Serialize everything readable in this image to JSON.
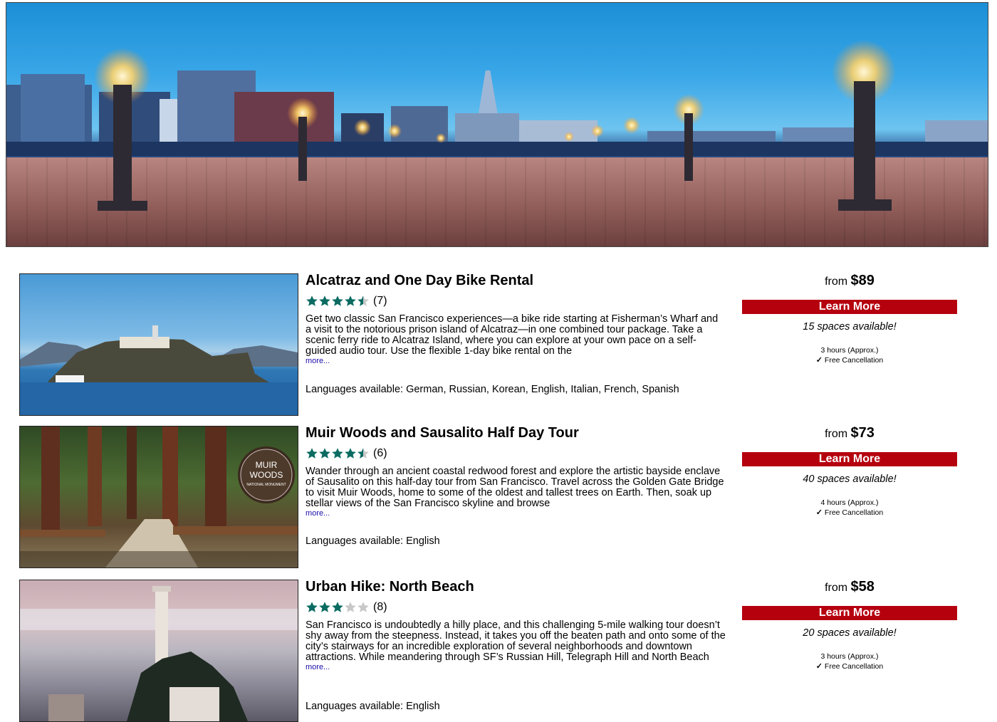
{
  "hero": {
    "alt": "San Francisco pier at dusk"
  },
  "tours": [
    {
      "title": "Alcatraz and One Day Bike Rental",
      "rating": 4.5,
      "reviews": "(7)",
      "description": "Get two classic San Francisco experiences—a bike ride starting at Fisherman’s Wharf and a visit to the notorious prison island of Alcatraz—in one combined tour package. Take a scenic ferry ride to Alcatraz Island, where you can explore at your own pace on a self-guided audio tour. Use the flexible 1-day bike rental on the",
      "more": "more...",
      "languages": "Languages available: German, Russian, Korean, English, Italian, French, Spanish",
      "from_label": "from",
      "price": "$89",
      "button": "Learn More",
      "spaces": "15 spaces available!",
      "duration": "3 hours (Approx.)",
      "cancellation": "Free Cancellation"
    },
    {
      "title": "Muir Woods and Sausalito Half Day Tour",
      "rating": 4.5,
      "reviews": "(6)",
      "description": "Wander through an ancient coastal redwood forest and explore the artistic bayside enclave of Sausalito on this half-day tour from San Francisco. Travel across the Golden Gate Bridge to visit Muir Woods, home to some of the oldest and tallest trees on Earth. Then, soak up stellar views of the San Francisco skyline and browse",
      "more": "more...",
      "languages": "Languages available: English",
      "from_label": "from",
      "price": "$73",
      "button": "Learn More",
      "spaces": "40 spaces available!",
      "duration": "4 hours (Approx.)",
      "cancellation": "Free Cancellation",
      "sign_line1": "MUIR",
      "sign_line2": "WOODS",
      "sign_line3": "NATIONAL MONUMENT"
    },
    {
      "title": "Urban Hike: North Beach",
      "rating": 3,
      "reviews": "(8)",
      "description": "San Francisco is undoubtedly a hilly place, and this challenging 5-mile walking tour doesn’t shy away from the steepness. Instead, it takes you off the beaten path and onto some of the city’s stairways for an incredible exploration of several neighborhoods and downtown attractions. While meandering through SF’s Russian Hill, Telegraph Hill and North Beach",
      "more": "more...",
      "languages": "Languages available: English",
      "from_label": "from",
      "price": "$58",
      "button": "Learn More",
      "spaces": "20 spaces available!",
      "duration": "3 hours (Approx.)",
      "cancellation": "Free Cancellation"
    }
  ],
  "colors": {
    "accent": "#b5000e",
    "star": "#0a6b61",
    "star_empty": "#c8c8c8",
    "link": "#1a0dab"
  },
  "icons": {
    "check": "check-icon",
    "star": "star-icon"
  }
}
